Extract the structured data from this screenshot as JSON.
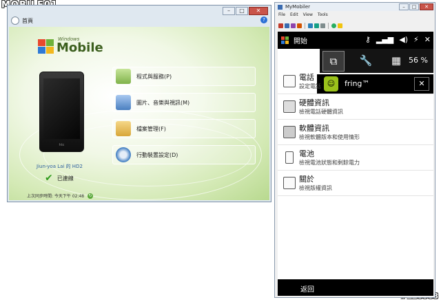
{
  "watermark_logo": "MOBILE01",
  "watermark_id": "#116068",
  "wmdc": {
    "nav_home": "首頁",
    "help": "?",
    "logo_small": "Windows",
    "logo_big": "Mobile",
    "device_name": "Jiun-yoa Lai 的 HD2",
    "connected": "已連線",
    "sync_status": "上次同步時間: 今天下午 02:48",
    "phone_brand": "htc",
    "menu": [
      {
        "label": "程式與服務(P)",
        "color": "#7fb24a"
      },
      {
        "label": "圖片、音樂與視訊(M)",
        "color": "#4a7fc0"
      },
      {
        "label": "檔案管理(F)",
        "color": "#d8a73a"
      },
      {
        "label": "行動裝置設定(D)",
        "color": "#3a79c0"
      }
    ]
  },
  "mymobiler": {
    "title": "MyMobiler",
    "menu": [
      "File",
      "Edit",
      "View",
      "Tools"
    ],
    "start": "開始",
    "battery_pct": "56 %",
    "fring_label": "fring™",
    "fring_close": "✕",
    "rows": [
      {
        "title": "電話",
        "sub": "設定電話"
      },
      {
        "title": "硬體資訊",
        "sub": "檢視電話硬體資訊"
      },
      {
        "title": "軟體資訊",
        "sub": "檢視軟體版本和使用情形"
      },
      {
        "title": "電池",
        "sub": "檢視電池狀態和剩餘電力"
      },
      {
        "title": "關於",
        "sub": "檢視版權資訊"
      }
    ],
    "back": "返回"
  }
}
